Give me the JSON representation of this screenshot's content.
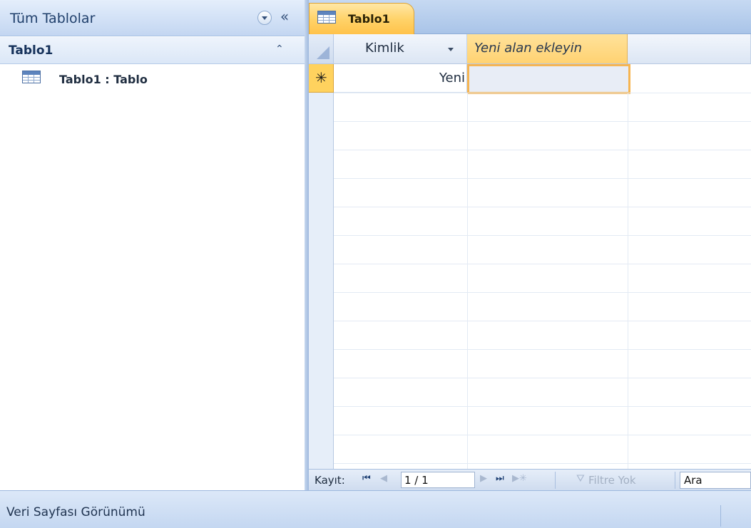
{
  "navigation_pane": {
    "title": "Tüm Tablolar",
    "dropdown_icon": "chevron-down-circle-icon",
    "collapse_label": "«",
    "group": {
      "title": "Tablo1",
      "collapse_label": "⌃"
    },
    "items": [
      {
        "label": "Tablo1 : Tablo",
        "icon": "table-icon"
      }
    ]
  },
  "document": {
    "tab": {
      "label": "Tablo1",
      "icon": "table-icon"
    },
    "datasheet": {
      "columns": [
        {
          "label": "Kimlik",
          "has_dropdown": true
        },
        {
          "label": "Yeni alan ekleyin"
        }
      ],
      "new_row": {
        "marker": "✳",
        "kimlik_value": "Yeni"
      }
    },
    "record_navigator": {
      "label": "Kayıt:",
      "first": "⏮",
      "prev": "◀",
      "current": "1 / 1",
      "next": "▶",
      "last": "⏭",
      "new": "▶✳",
      "filter_icon": "funnel-icon",
      "filter_label": "Filtre Yok",
      "search_value": "Ara"
    }
  },
  "status_bar": {
    "text": "Veri Sayfası Görünümü"
  },
  "colors": {
    "accent_tab": "#ffd36a",
    "nav_header": "#d2e1f6",
    "active_cell_border": "#f6b552"
  }
}
